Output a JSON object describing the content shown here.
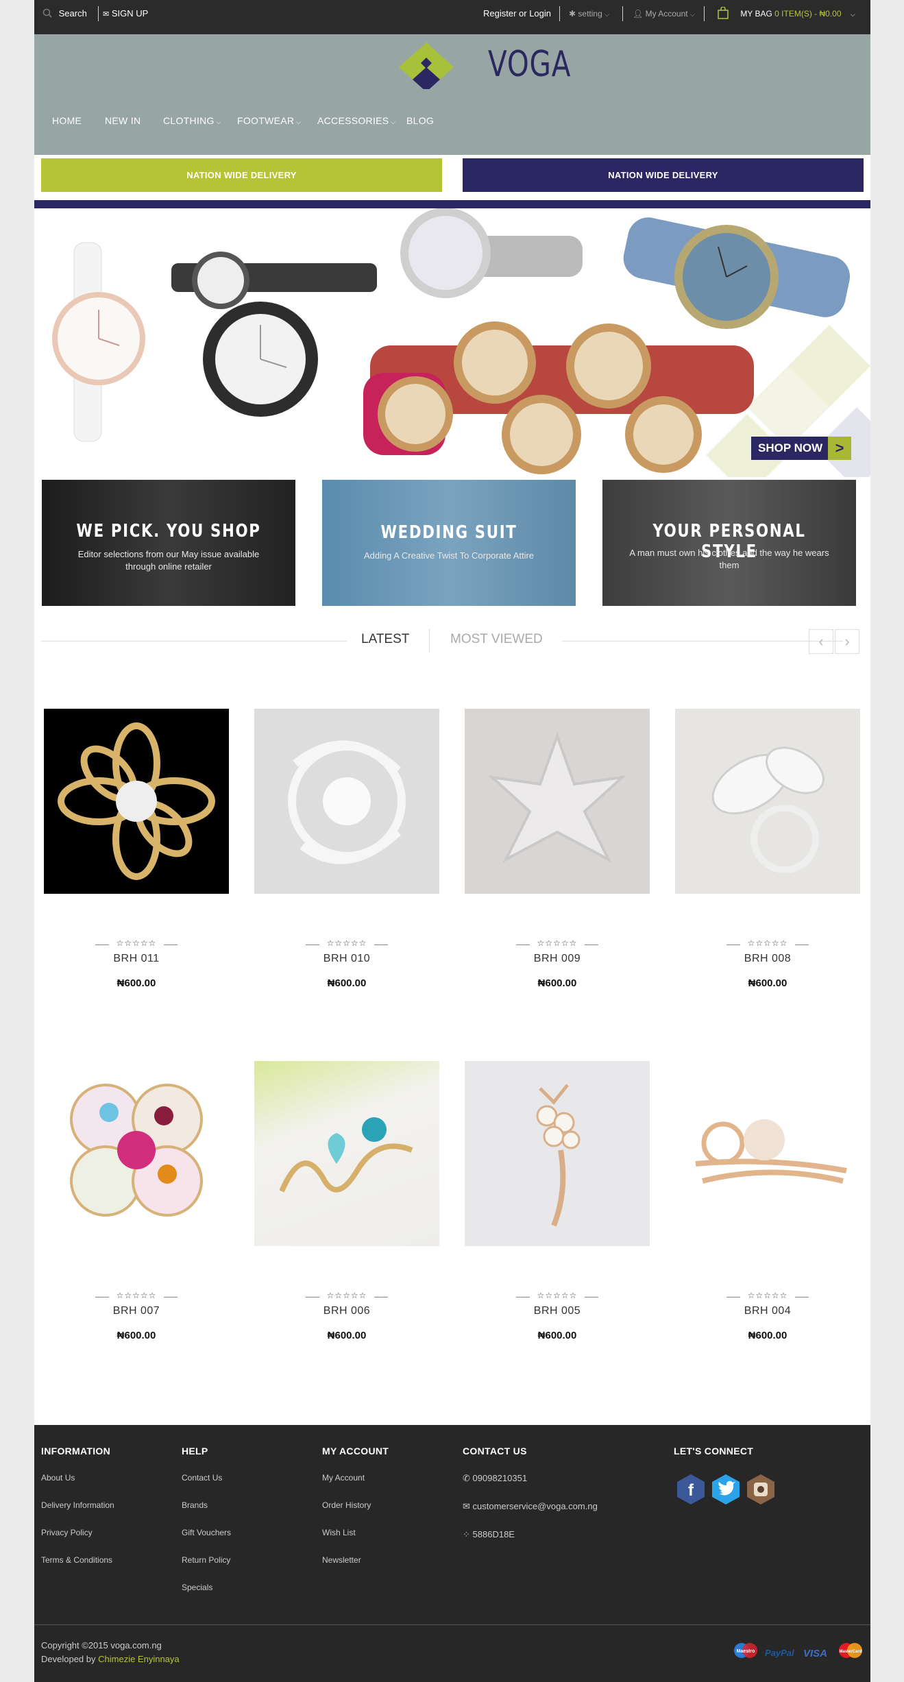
{
  "topbar": {
    "search_label": "Search",
    "signup_label": "SIGN UP",
    "register_login": "Register or Login",
    "setting_label": "setting",
    "account_label": "My Account",
    "bag_label": "MY BAG",
    "bag_summary": "0 ITEM(S) - ₦0.00"
  },
  "brand": {
    "name": "VOGA"
  },
  "nav": {
    "items": [
      {
        "label": "HOME"
      },
      {
        "label": "NEW IN"
      },
      {
        "label": "CLOTHING",
        "has_dropdown": true
      },
      {
        "label": "FOOTWEAR",
        "has_dropdown": true
      },
      {
        "label": "ACCESSORIES",
        "has_dropdown": true
      },
      {
        "label": "BLOG"
      }
    ]
  },
  "delivery": {
    "left": "NATION WIDE DELIVERY",
    "right": "NATION WIDE DELIVERY"
  },
  "hero": {
    "cta": "SHOP NOW"
  },
  "banners": [
    {
      "title": "WE PICK. YOU SHOP",
      "subtitle": "Editor selections from our May issue available through online retailer"
    },
    {
      "title": "WEDDING SUIT",
      "subtitle": "Adding A Creative Twist To Corporate Attire"
    },
    {
      "title": "YOUR PERSONAL STYLE",
      "subtitle": "A man must own his clothes and the way he wears them"
    }
  ],
  "tabs": {
    "latest": "LATEST",
    "most_viewed": "MOST VIEWED"
  },
  "products": [
    {
      "name": "BRH 011",
      "price": "₦600.00",
      "stars": "☆☆☆☆☆"
    },
    {
      "name": "BRH 010",
      "price": "₦600.00",
      "stars": "☆☆☆☆☆"
    },
    {
      "name": "BRH 009",
      "price": "₦600.00",
      "stars": "☆☆☆☆☆"
    },
    {
      "name": "BRH 008",
      "price": "₦600.00",
      "stars": "☆☆☆☆☆"
    },
    {
      "name": "BRH 007",
      "price": "₦600.00",
      "stars": "☆☆☆☆☆"
    },
    {
      "name": "BRH 006",
      "price": "₦600.00",
      "stars": "☆☆☆☆☆"
    },
    {
      "name": "BRH 005",
      "price": "₦600.00",
      "stars": "☆☆☆☆☆"
    },
    {
      "name": "BRH 004",
      "price": "₦600.00",
      "stars": "☆☆☆☆☆"
    }
  ],
  "footer": {
    "information": {
      "title": "INFORMATION",
      "links": [
        "About Us",
        "Delivery Information",
        "Privacy Policy",
        "Terms & Conditions"
      ]
    },
    "help": {
      "title": "HELP",
      "links": [
        "Contact Us",
        "Brands",
        "Gift Vouchers",
        "Return Policy",
        "Specials"
      ]
    },
    "my_account": {
      "title": "MY ACCOUNT",
      "links": [
        "My Account",
        "Order History",
        "Wish List",
        "Newsletter"
      ]
    },
    "contact": {
      "title": "CONTACT US",
      "phone": "09098210351",
      "email": "customerservice@voga.com.ng",
      "bbm": "5886D18E"
    },
    "connect": {
      "title": "LET'S CONNECT"
    },
    "copyright": "Copyright ©2015 voga.com.ng",
    "developed_prefix": "Developed by",
    "developer": "Chimezie Enyinnaya",
    "payments": [
      "Maestro",
      "PayPal",
      "VISA",
      "MasterCard"
    ]
  },
  "colors": {
    "accent": "#b5c634",
    "navy": "#2b2763",
    "header_bg": "#97a6a5",
    "footer_bg": "#272727"
  }
}
